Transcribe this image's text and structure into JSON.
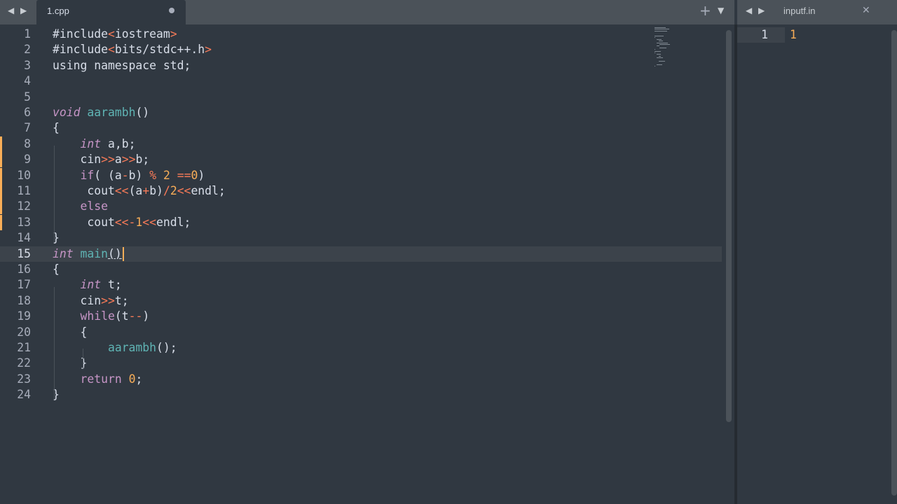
{
  "left_tabs": {
    "active_tab": {
      "title": "1.cpp",
      "modified": true
    }
  },
  "right_tabs": {
    "active_tab": {
      "title": "inputf.in"
    }
  },
  "icons": {
    "nav_back": "◀",
    "nav_forward": "▶",
    "new_tab": "+",
    "tab_menu": "▼",
    "close": "✕"
  },
  "current_line": 15,
  "modified_lines": [
    8,
    9,
    10,
    11,
    12,
    13
  ],
  "code": [
    {
      "n": "1",
      "tokens": [
        [
          "pl",
          "#include"
        ],
        [
          "op",
          "<"
        ],
        [
          "pl",
          "iostream"
        ],
        [
          "op",
          ">"
        ]
      ]
    },
    {
      "n": "2",
      "tokens": [
        [
          "pl",
          "#include"
        ],
        [
          "op",
          "<"
        ],
        [
          "pl",
          "bits/stdc++.h"
        ],
        [
          "op",
          ">"
        ]
      ]
    },
    {
      "n": "3",
      "tokens": [
        [
          "pl",
          "using namespace std;"
        ]
      ]
    },
    {
      "n": "4",
      "tokens": []
    },
    {
      "n": "5",
      "tokens": []
    },
    {
      "n": "6",
      "tokens": [
        [
          "st",
          "void"
        ],
        [
          "pl",
          " "
        ],
        [
          "fn",
          "aarambh"
        ],
        [
          "pl",
          "()"
        ]
      ]
    },
    {
      "n": "7",
      "tokens": [
        [
          "pl",
          "{"
        ]
      ]
    },
    {
      "n": "8",
      "tokens": [
        [
          "pl",
          "    "
        ],
        [
          "st",
          "int"
        ],
        [
          "pl",
          " a,b;"
        ]
      ]
    },
    {
      "n": "9",
      "tokens": [
        [
          "pl",
          "    cin"
        ],
        [
          "op",
          ">>"
        ],
        [
          "pl",
          "a"
        ],
        [
          "op",
          ">>"
        ],
        [
          "pl",
          "b;"
        ]
      ]
    },
    {
      "n": "10",
      "tokens": [
        [
          "pl",
          "    "
        ],
        [
          "kw",
          "if"
        ],
        [
          "pl",
          "( (a"
        ],
        [
          "op",
          "-"
        ],
        [
          "pl",
          "b) "
        ],
        [
          "op",
          "%"
        ],
        [
          "pl",
          " "
        ],
        [
          "nm",
          "2"
        ],
        [
          "pl",
          " "
        ],
        [
          "op",
          "=="
        ],
        [
          "nm",
          "0"
        ],
        [
          "pl",
          ")"
        ]
      ]
    },
    {
      "n": "11",
      "tokens": [
        [
          "pl",
          "     cout"
        ],
        [
          "op",
          "<<"
        ],
        [
          "pl",
          "(a"
        ],
        [
          "op",
          "+"
        ],
        [
          "pl",
          "b)"
        ],
        [
          "op",
          "/"
        ],
        [
          "nm",
          "2"
        ],
        [
          "op",
          "<<"
        ],
        [
          "pl",
          "endl;"
        ]
      ]
    },
    {
      "n": "12",
      "tokens": [
        [
          "pl",
          "    "
        ],
        [
          "kw",
          "else"
        ]
      ]
    },
    {
      "n": "13",
      "tokens": [
        [
          "pl",
          "     cout"
        ],
        [
          "op",
          "<<-"
        ],
        [
          "nm",
          "1"
        ],
        [
          "op",
          "<<"
        ],
        [
          "pl",
          "endl;"
        ]
      ]
    },
    {
      "n": "14",
      "tokens": [
        [
          "pl",
          "}"
        ]
      ]
    },
    {
      "n": "15",
      "tokens": [
        [
          "st",
          "int"
        ],
        [
          "pl",
          " "
        ],
        [
          "fn",
          "main"
        ],
        [
          "cb",
          "()"
        ]
      ]
    },
    {
      "n": "16",
      "tokens": [
        [
          "pl",
          "{"
        ]
      ]
    },
    {
      "n": "17",
      "tokens": [
        [
          "pl",
          "    "
        ],
        [
          "st",
          "int"
        ],
        [
          "pl",
          " t;"
        ]
      ]
    },
    {
      "n": "18",
      "tokens": [
        [
          "pl",
          "    cin"
        ],
        [
          "op",
          ">>"
        ],
        [
          "pl",
          "t;"
        ]
      ]
    },
    {
      "n": "19",
      "tokens": [
        [
          "pl",
          "    "
        ],
        [
          "kw",
          "while"
        ],
        [
          "pl",
          "(t"
        ],
        [
          "op",
          "--"
        ],
        [
          "pl",
          ")"
        ]
      ]
    },
    {
      "n": "20",
      "tokens": [
        [
          "pl",
          "    {"
        ]
      ]
    },
    {
      "n": "21",
      "tokens": [
        [
          "pl",
          "        "
        ],
        [
          "fn",
          "aarambh"
        ],
        [
          "pl",
          "();"
        ]
      ]
    },
    {
      "n": "22",
      "tokens": [
        [
          "pl",
          "    }"
        ]
      ]
    },
    {
      "n": "23",
      "tokens": [
        [
          "pl",
          "    "
        ],
        [
          "kw",
          "return"
        ],
        [
          "pl",
          " "
        ],
        [
          "nm",
          "0"
        ],
        [
          "pl",
          ";"
        ]
      ]
    },
    {
      "n": "24",
      "tokens": [
        [
          "pl",
          "}"
        ]
      ]
    }
  ],
  "input_file": [
    {
      "n": "1",
      "text": "1"
    }
  ],
  "colors": {
    "background": "#303841",
    "tabbar": "#4b5259",
    "text": "#d8dee9",
    "keyword": "#c695c6",
    "function": "#5fb4b4",
    "operator": "#f97b58",
    "number": "#f9ae58",
    "gutter_mark": "#f9ae58"
  }
}
